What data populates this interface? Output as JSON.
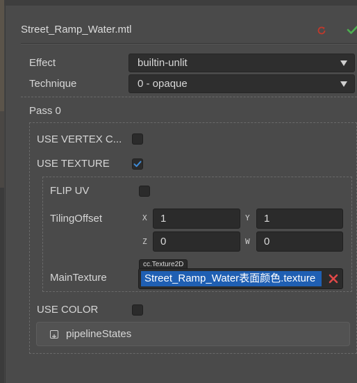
{
  "header": {
    "title": "Street_Ramp_Water.mtl",
    "revert_icon": "revert-icon",
    "apply_icon": "checkmark-icon"
  },
  "effect": {
    "label": "Effect",
    "value": "builtin-unlit"
  },
  "technique": {
    "label": "Technique",
    "value": "0 - opaque"
  },
  "pass": {
    "label": "Pass 0",
    "use_vertex_color": {
      "label": "USE VERTEX C...",
      "checked": false
    },
    "use_texture": {
      "label": "USE TEXTURE",
      "checked": true
    },
    "flip_uv": {
      "label": "FLIP UV",
      "checked": false
    },
    "tiling_offset": {
      "label": "TilingOffset",
      "x_label": "X",
      "x": "1",
      "y_label": "Y",
      "y": "1",
      "z_label": "Z",
      "z": "0",
      "w_label": "W",
      "w": "0"
    },
    "main_texture": {
      "label": "MainTexture",
      "type_tag": "cc.Texture2D",
      "value": "Street_Ramp_Water表面颜色.texture"
    },
    "use_color": {
      "label": "USE COLOR",
      "checked": false
    },
    "pipeline_states": {
      "label": "pipelineStates"
    }
  },
  "colors": {
    "panel_bg": "#4a4a4a",
    "field_bg": "#2b2b2b",
    "selection": "#1f5fb3",
    "checkmark": "#3f8bd6",
    "revert": "#c0392b",
    "apply": "#4caf50",
    "clear": "#e04848"
  }
}
